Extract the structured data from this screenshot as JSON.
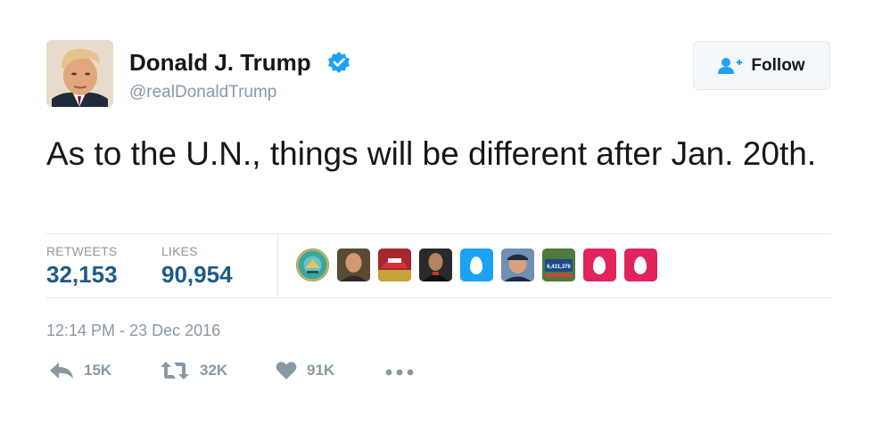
{
  "author": {
    "name": "Donald J. Trump",
    "handle": "@realDonaldTrump",
    "verified": true
  },
  "follow_button": {
    "label": "Follow"
  },
  "tweet": {
    "text": "As to the U.N., things will be different after Jan. 20th.",
    "timestamp": "12:14 PM - 23 Dec 2016"
  },
  "stats": {
    "retweets_label": "RETWEETS",
    "retweets_value": "32,153",
    "likes_label": "LIKES",
    "likes_value": "90,954"
  },
  "likers": [
    {
      "kind": "avatar",
      "icon": "emblem-avatar"
    },
    {
      "kind": "avatar",
      "icon": "person-avatar"
    },
    {
      "kind": "avatar",
      "icon": "campaign-hat-avatar"
    },
    {
      "kind": "avatar",
      "icon": "person-avatar"
    },
    {
      "kind": "egg",
      "icon": "egg-avatar",
      "color": "#1da1f2"
    },
    {
      "kind": "avatar",
      "icon": "person-avatar"
    },
    {
      "kind": "avatar",
      "icon": "sign-avatar",
      "sign_text": "6,431,376"
    },
    {
      "kind": "egg",
      "icon": "egg-avatar",
      "color": "#e0245e"
    },
    {
      "kind": "egg",
      "icon": "egg-avatar",
      "color": "#e0245e"
    }
  ],
  "actions": {
    "reply_count": "15K",
    "retweet_count": "32K",
    "like_count": "91K"
  },
  "colors": {
    "verified_blue": "#1da1f2",
    "link_blue": "#1b5b8a",
    "muted_gray": "#8899a6"
  }
}
